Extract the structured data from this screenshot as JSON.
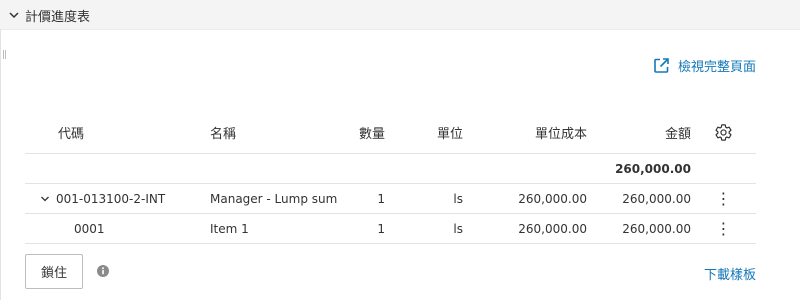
{
  "panel": {
    "title": "計價進度表"
  },
  "actions": {
    "view_full_page": "檢視完整頁面",
    "lock": "鎖住",
    "download_template": "下載樣板"
  },
  "table": {
    "columns": [
      "代碼",
      "名稱",
      "數量",
      "單位",
      "單位成本",
      "金額"
    ],
    "total_amount": "260,000.00",
    "rows": [
      {
        "code": "001-013100-2-INT",
        "name": "Manager - Lump sum",
        "qty": "1",
        "unit": "ls",
        "unit_cost": "260,000.00",
        "amount": "260,000.00",
        "expanded": true
      },
      {
        "code": "0001",
        "name": "Item 1",
        "qty": "1",
        "unit": "ls",
        "unit_cost": "260,000.00",
        "amount": "260,000.00"
      }
    ]
  },
  "colors": {
    "link": "#1478b8",
    "header_bg": "#f4f4f4",
    "border": "#e3e3e3"
  },
  "icons": {
    "collapse": "chevron-down-icon",
    "external": "external-link-icon",
    "settings": "gear-icon",
    "row_menu": "kebab-icon",
    "info": "info-icon"
  }
}
